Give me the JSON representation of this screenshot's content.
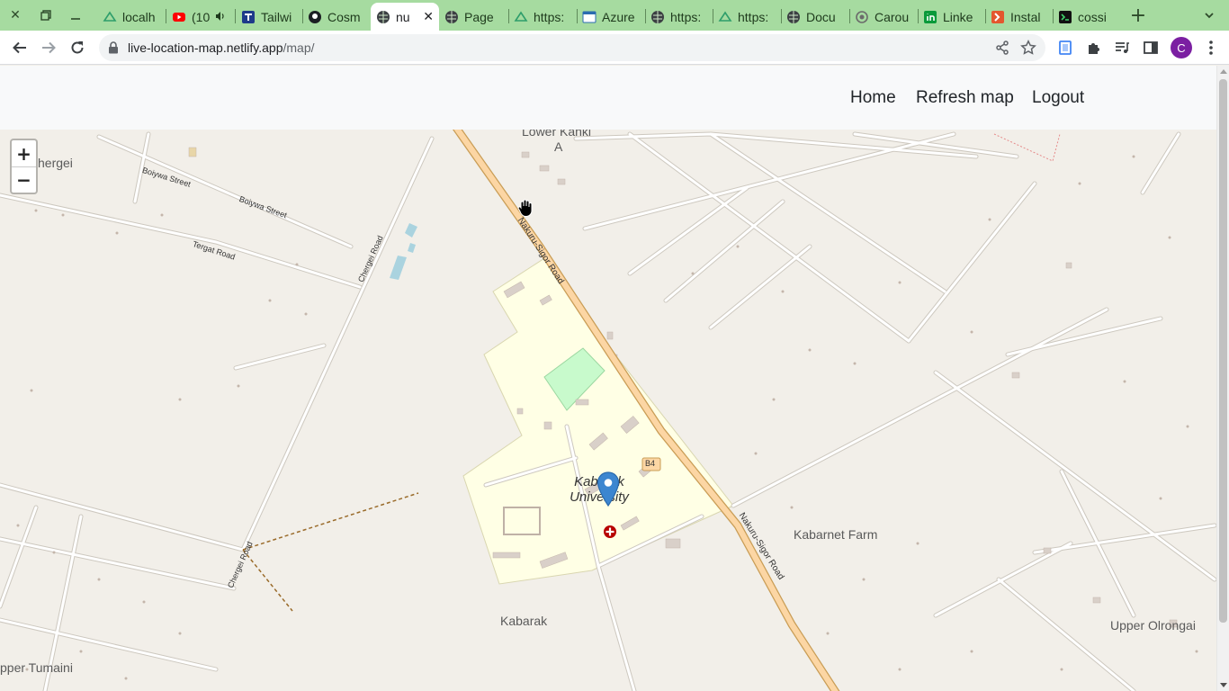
{
  "browser": {
    "tabs": [
      {
        "title": "localh",
        "favicon": "netlify-icon"
      },
      {
        "title": "(10",
        "favicon": "youtube-icon",
        "audio": true
      },
      {
        "title": "Tailwi",
        "favicon": "tailwind-icon"
      },
      {
        "title": "Cosm",
        "favicon": "github-icon"
      },
      {
        "title": "nu",
        "favicon": "globe-icon",
        "active": true
      },
      {
        "title": "Page",
        "favicon": "globe-icon"
      },
      {
        "title": "https:",
        "favicon": "netlify-icon"
      },
      {
        "title": "Azure",
        "favicon": "azure-icon"
      },
      {
        "title": "https:",
        "favicon": "globe-icon"
      },
      {
        "title": "https:",
        "favicon": "netlify-icon"
      },
      {
        "title": "Docu",
        "favicon": "globe-icon"
      },
      {
        "title": "Carou",
        "favicon": "openai-icon"
      },
      {
        "title": "Linke",
        "favicon": "linkedin-icon"
      },
      {
        "title": "Instal",
        "favicon": "install-icon"
      },
      {
        "title": "cossi",
        "favicon": "terminal-icon"
      }
    ],
    "url_host": "live-location-map.netlify.app",
    "url_path": "/map/",
    "profile_initial": "C"
  },
  "nav": {
    "home": "Home",
    "refresh": "Refresh map",
    "logout": "Logout"
  },
  "map": {
    "zoom_in": "+",
    "zoom_out": "−",
    "labels": {
      "lower_kanki": "Lower Kanki",
      "lower_kanki_a": "A",
      "chergei": "hergei",
      "boiywa_street_1": "Boiywa Street",
      "boiywa_street_2": "Boiywa Street",
      "tergat_road": "Tergat Road",
      "chergei_road_1": "Chergei Road",
      "chergei_road_2": "Chergei Road",
      "nakuru_sigor_1": "Nakuru-Sigor Road",
      "nakuru_sigor_2": "Nakuru-Sigor Road",
      "b4": "B4",
      "campus_1": "Kabarak",
      "campus_2": "University",
      "kabarak": "Kabarak",
      "kabarnet_farm": "Kabarnet Farm",
      "upper_olrongai": "Upper Olrongai",
      "upper_tumaini": "pper Tumaini"
    },
    "colors": {
      "land": "#f2efe9",
      "campus": "#ffffe5",
      "main_road": "#fcd6a4",
      "main_road_casing": "#c99d56",
      "minor_road": "#ffffff",
      "minor_road_casing": "#cdc8bf",
      "pitch": "#c8facc",
      "water": "#aad3df",
      "marker": "#3c86d0",
      "hospital": "#b70000"
    }
  }
}
